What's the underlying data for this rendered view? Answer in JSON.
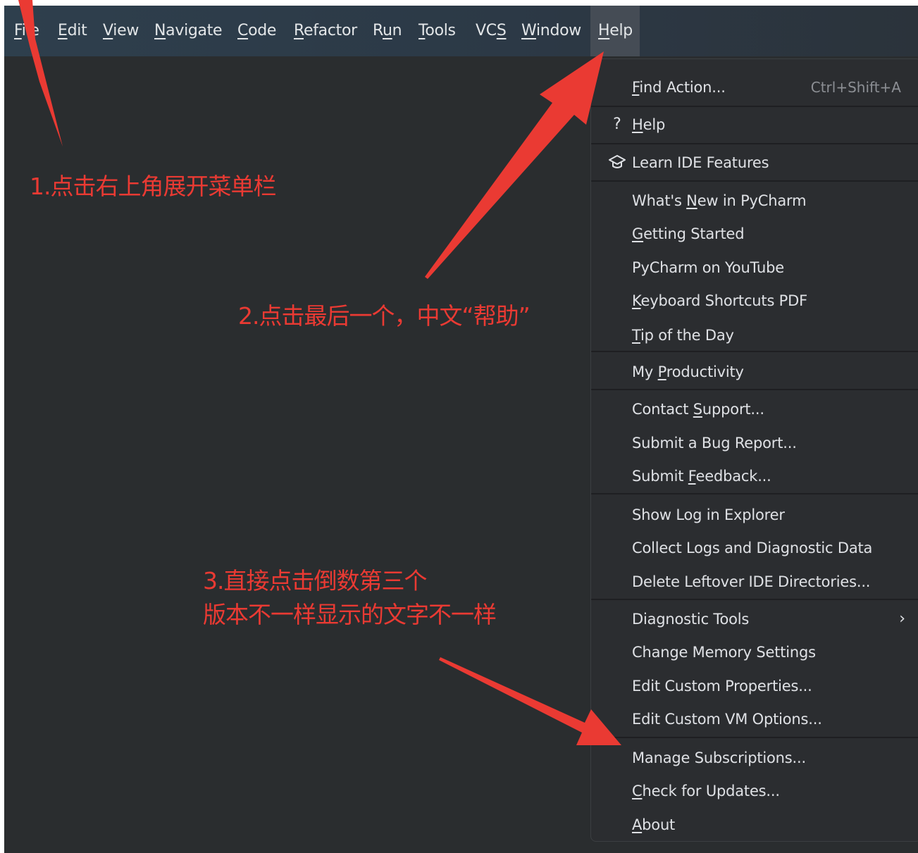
{
  "menubar": {
    "items": [
      {
        "pre": "",
        "mn": "F",
        "post": "ile"
      },
      {
        "pre": "",
        "mn": "E",
        "post": "dit"
      },
      {
        "pre": "",
        "mn": "V",
        "post": "iew"
      },
      {
        "pre": "",
        "mn": "N",
        "post": "avigate"
      },
      {
        "pre": "",
        "mn": "C",
        "post": "ode"
      },
      {
        "pre": "",
        "mn": "R",
        "post": "efactor"
      },
      {
        "pre": "R",
        "mn": "u",
        "post": "n"
      },
      {
        "pre": "",
        "mn": "T",
        "post": "ools"
      },
      {
        "pre": "VC",
        "mn": "S",
        "post": ""
      },
      {
        "pre": "",
        "mn": "W",
        "post": "indow"
      },
      {
        "pre": "",
        "mn": "H",
        "post": "elp"
      }
    ]
  },
  "help_menu": {
    "items": [
      {
        "pre": "",
        "mn": "F",
        "post": "ind Action...",
        "shortcut": "Ctrl+Shift+A"
      },
      {
        "pre": "",
        "mn": "H",
        "post": "elp",
        "icon": "?"
      },
      {
        "pre": "Learn IDE Features",
        "mn": "",
        "post": "",
        "icon": "graduation-cap"
      },
      {
        "pre": "What's ",
        "mn": "N",
        "post": "ew in PyCharm"
      },
      {
        "pre": "",
        "mn": "G",
        "post": "etting Started"
      },
      {
        "pre": "PyCharm on YouTube",
        "mn": "",
        "post": ""
      },
      {
        "pre": "",
        "mn": "K",
        "post": "eyboard Shortcuts PDF"
      },
      {
        "pre": "",
        "mn": "T",
        "post": "ip of the Day"
      },
      {
        "pre": "My ",
        "mn": "P",
        "post": "roductivity"
      },
      {
        "pre": "Contact ",
        "mn": "S",
        "post": "upport..."
      },
      {
        "pre": "Submit a Bug Report...",
        "mn": "",
        "post": ""
      },
      {
        "pre": "Submit ",
        "mn": "F",
        "post": "eedback..."
      },
      {
        "pre": "Show Log in Explorer",
        "mn": "",
        "post": ""
      },
      {
        "pre": "Collect Logs and Diagnostic Data",
        "mn": "",
        "post": ""
      },
      {
        "pre": "Delete Leftover IDE Directories...",
        "mn": "",
        "post": ""
      },
      {
        "pre": "Diagnostic Tools",
        "mn": "",
        "post": "",
        "submenu": "›"
      },
      {
        "pre": "Change Memory Settings",
        "mn": "",
        "post": ""
      },
      {
        "pre": "Edit Custom Properties...",
        "mn": "",
        "post": ""
      },
      {
        "pre": "Edit Custom VM Options...",
        "mn": "",
        "post": ""
      },
      {
        "pre": "Manage Subscriptions...",
        "mn": "",
        "post": ""
      },
      {
        "pre": "",
        "mn": "C",
        "post": "heck for Updates..."
      },
      {
        "pre": "",
        "mn": "A",
        "post": "bout"
      }
    ]
  },
  "annotations": {
    "step1": "1.点击右上角展开菜单栏",
    "step2": "2.点击最后一个，中文“帮助”",
    "step3_line1": "3.直接点击倒数第三个",
    "step3_line2": "版本不一样显示的文字不一样"
  },
  "colors": {
    "annotation": "#ea3a33",
    "menu_bg": "#2b2d30",
    "editor_bg": "#2a2d2f"
  }
}
